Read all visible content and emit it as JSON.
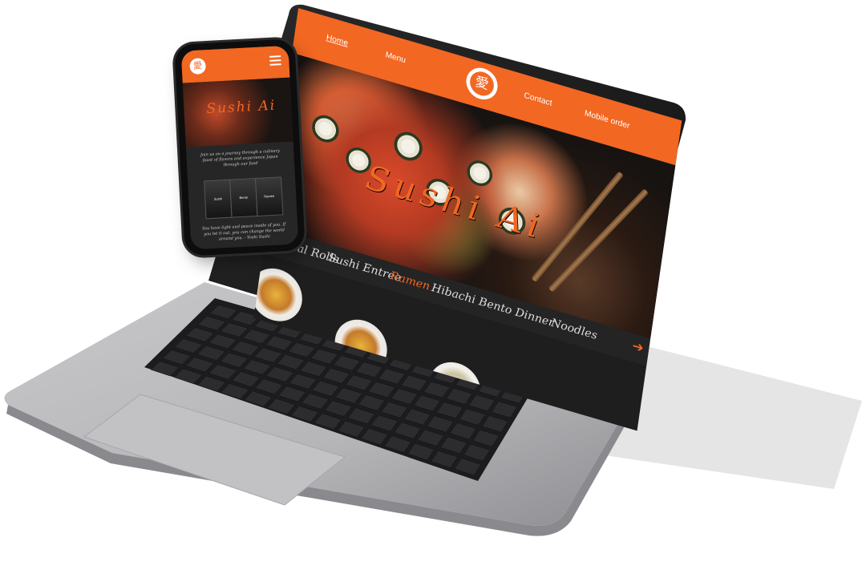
{
  "laptop_site": {
    "nav": {
      "home": "Home",
      "menu": "Menu",
      "contact": "Contact",
      "mobile_order": "Mobile order",
      "logo_glyph": "愛"
    },
    "hero_title": "Sushi Ai",
    "categories": [
      "Special Rolls",
      "Sushi Entree",
      "Ramen",
      "Hibachi",
      "Bento Dinner",
      "Noodles"
    ],
    "active_category": "Ramen",
    "next_icon": "arrow-right-icon"
  },
  "phone_site": {
    "logo_glyph": "愛",
    "menu_icon": "hamburger-icon",
    "hero_title": "Sushi Ai",
    "intro_text": "Join us on a journey through a culinary feast of flavors and experience Japan through our food",
    "cards": [
      "Sushi",
      "Bento",
      "Ramen"
    ],
    "quote_text": "You have light and peace inside of you. If you let it out, you can change the world around you. - Yoshi Sushi"
  },
  "colors": {
    "accent": "#f26722",
    "dark": "#1e1e1e",
    "laptop_silver": "#b8b8bc"
  }
}
